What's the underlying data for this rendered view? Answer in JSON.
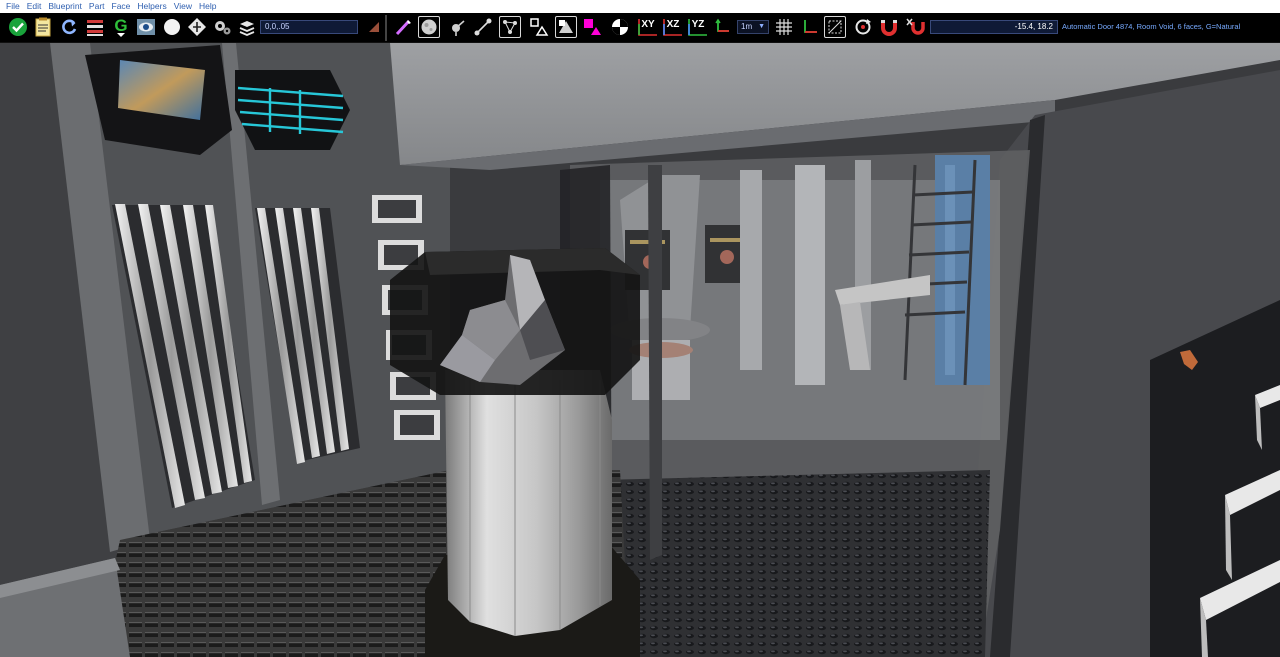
{
  "menubar": {
    "items": [
      "File",
      "Edit",
      "Blueprint",
      "Part",
      "Face",
      "Helpers",
      "View",
      "Help"
    ]
  },
  "toolbar": {
    "coord_value": "0,0,.05",
    "grid_size": "1m",
    "grid_dropdown_arrow": "▼",
    "axis_xy": "XY",
    "axis_xz": "XZ",
    "axis_yz": "YZ",
    "group_label": "G",
    "position_readout": "-15.4, 18.2",
    "status_text": "Automatic Door 4874, Room Void, 6 faces, G=Natural"
  },
  "colors": {
    "accent_check": "#19a33b",
    "accent_green": "#2fbf3a",
    "accent_magenta": "#ff00d8",
    "readout_bg": "#0f1a36",
    "status_text": "#77aaff",
    "axis_x_red": "#e03030",
    "axis_y_green": "#30c040"
  },
  "icons": [
    "confirm-check-icon",
    "notepad-icon",
    "refresh-icon",
    "layers-list-icon",
    "group-g-icon",
    "preview-eye-icon",
    "sphere-icon",
    "diamond-move-icon",
    "gear-settings-icon",
    "stack-icon",
    "brush-icon",
    "wand-icon",
    "moon-sphere-icon",
    "pin-tool-icon",
    "line-tool-icon",
    "node-tool-icon",
    "shapes-icon",
    "triangle-icon",
    "magenta-square-icon",
    "quadrant-icon",
    "xyz-axis-icon",
    "grid-icon",
    "axis-origin-icon",
    "select-frame-icon",
    "rotate-icon",
    "magnet-icon",
    "snap-magnet-icon",
    "flip-icon"
  ]
}
